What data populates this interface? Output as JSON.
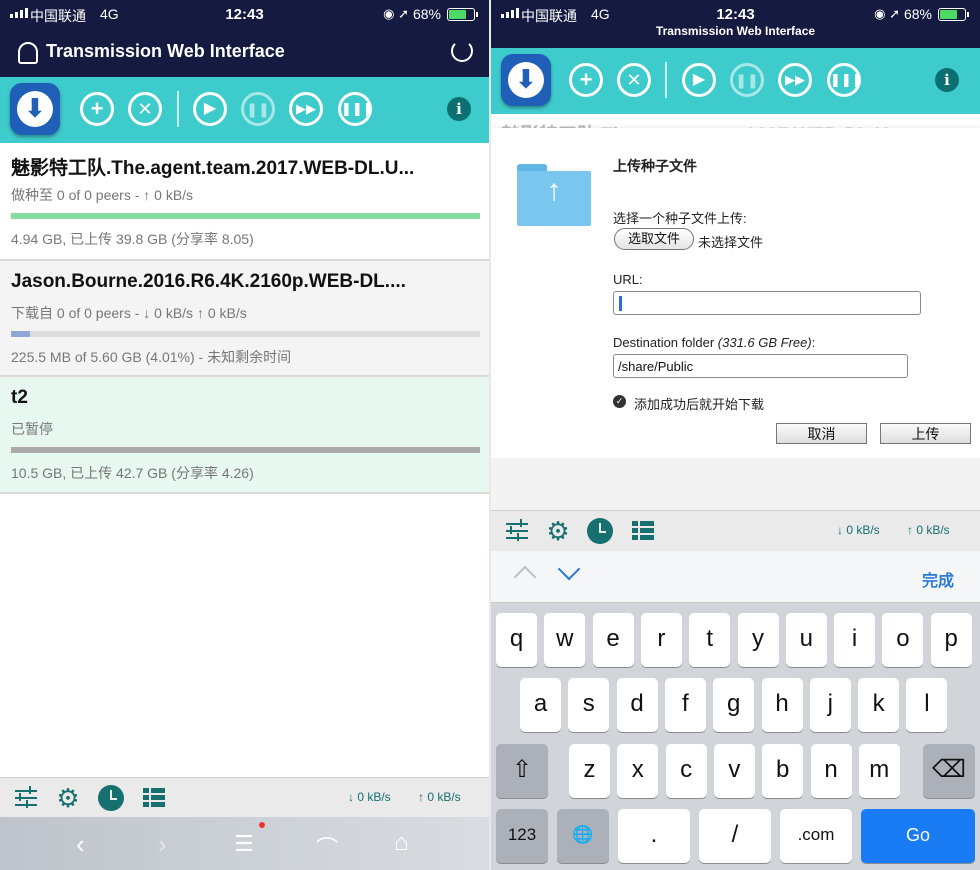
{
  "status": {
    "carrier": "中国联通",
    "network": "4G",
    "time": "12:43",
    "battery": "68%"
  },
  "left": {
    "header_title": "Transmission Web Interface",
    "torrents": [
      {
        "name": "魅影特工队.The.agent.team.2017.WEB-DL.U...",
        "peers": "做种至 0 of 0 peers - ↑ 0 kB/s",
        "progress": 1.0,
        "bar_color": "#86dda4",
        "stats": "4.94 GB, 已上传 39.8 GB (分享率 8.05)"
      },
      {
        "name": "Jason.Bourne.2016.R6.4K.2160p.WEB-DL....",
        "peers": "下载自 0 of 0 peers - ↓ 0 kB/s ↑ 0 kB/s",
        "progress": 0.0401,
        "bar_color": "#8fa6d6",
        "stats": "225.5 MB of 5.60 GB (4.01%) - 未知剩余时间"
      },
      {
        "name": "t2",
        "peers": "已暂停",
        "progress": 1.0,
        "bar_color": "#aaaaaa",
        "stats": "10.5 GB, 已上传 42.7 GB (分享率 4.26)"
      }
    ],
    "down_speed": "↓ 0 kB/s",
    "up_speed": "↑ 0 kB/s"
  },
  "right": {
    "header_title": "Transmission Web Interface",
    "behind_text": "魅影特工队.The.agent.team.2017.WEB-DL.U...",
    "dialog": {
      "title": "上传种子文件",
      "choose_label": "选择一个种子文件上传:",
      "choose_button": "选取文件",
      "no_file": "未选择文件",
      "url_label": "URL:",
      "url_value": "",
      "dest_label": "Destination folder",
      "dest_free": "(331.6 GB Free)",
      "dest_value": "/share/Public",
      "autostart_label": "添加成功后就开始下载",
      "cancel": "取消",
      "upload": "上传"
    },
    "down_speed": "↓ 0 kB/s",
    "up_speed": "↑ 0 kB/s",
    "keyboard": {
      "done": "完成",
      "row1": [
        "q",
        "w",
        "e",
        "r",
        "t",
        "y",
        "u",
        "i",
        "o",
        "p"
      ],
      "row2": [
        "a",
        "s",
        "d",
        "f",
        "g",
        "h",
        "j",
        "k",
        "l"
      ],
      "row3": [
        "z",
        "x",
        "c",
        "v",
        "b",
        "n",
        "m"
      ],
      "num": "123",
      "dot": ".",
      "slash": "/",
      "com": ".com",
      "go": "Go"
    }
  }
}
